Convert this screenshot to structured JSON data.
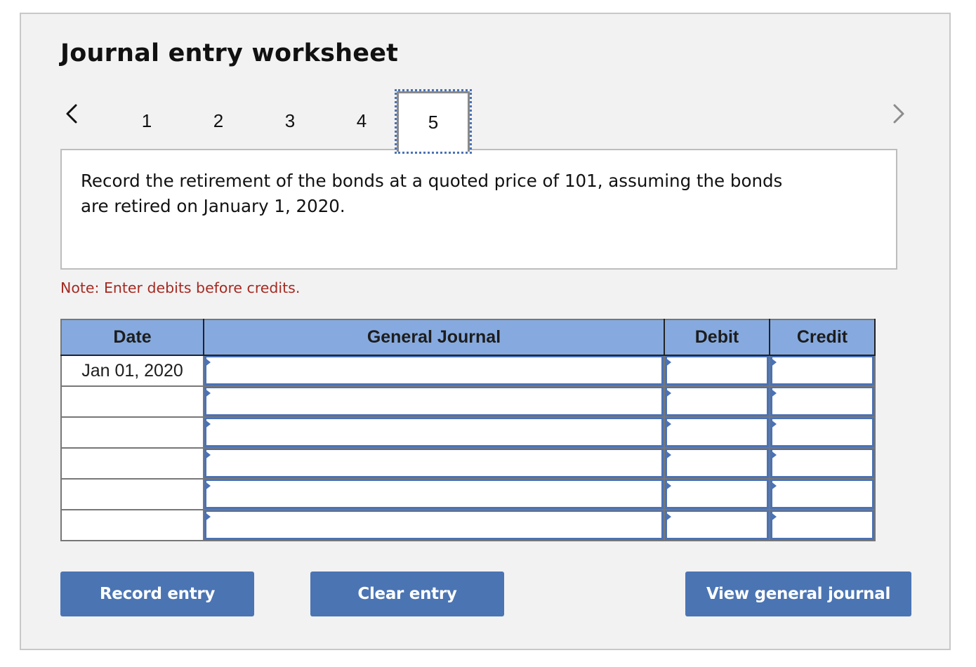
{
  "worksheet": {
    "title": "Journal entry worksheet",
    "nav": {
      "prev_icon": "chevron-left-icon",
      "next_icon": "chevron-right-icon",
      "next_enabled": false,
      "tabs": [
        {
          "label": "1",
          "active": false
        },
        {
          "label": "2",
          "active": false
        },
        {
          "label": "3",
          "active": false
        },
        {
          "label": "4",
          "active": false
        },
        {
          "label": "5",
          "active": true
        }
      ]
    },
    "question": "Record the retirement of the bonds at a quoted price of 101, assuming the bonds are retired on January 1, 2020.",
    "note": "Note: Enter debits before credits.",
    "table": {
      "columns": [
        "Date",
        "General Journal",
        "Debit",
        "Credit"
      ],
      "rows": [
        {
          "date": "Jan 01, 2020",
          "account": "",
          "debit": "",
          "credit": ""
        },
        {
          "date": "",
          "account": "",
          "debit": "",
          "credit": ""
        },
        {
          "date": "",
          "account": "",
          "debit": "",
          "credit": ""
        },
        {
          "date": "",
          "account": "",
          "debit": "",
          "credit": ""
        },
        {
          "date": "",
          "account": "",
          "debit": "",
          "credit": ""
        },
        {
          "date": "",
          "account": "",
          "debit": "",
          "credit": ""
        }
      ]
    },
    "buttons": {
      "record": "Record entry",
      "clear": "Clear entry",
      "view": "View general journal"
    },
    "colors": {
      "accent": "#4b74b3",
      "header_bg": "#86aadf",
      "note": "#a52a22",
      "panel_bg": "#f2f2f2"
    }
  }
}
